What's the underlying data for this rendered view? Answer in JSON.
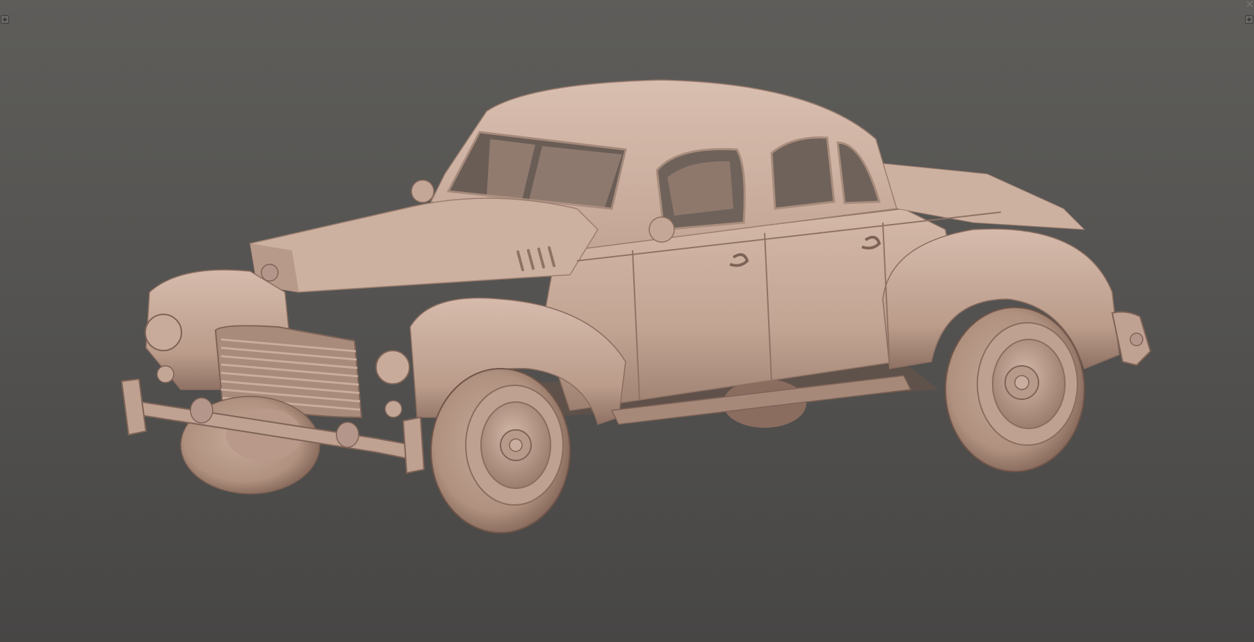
{
  "viewport": {
    "name": "3D viewport",
    "background_top": "#5e5d5a",
    "background_bottom": "#474645",
    "model_color": "#c9ad9e"
  },
  "controls": {
    "left_corner_icon": "plus-icon",
    "right_corner_icon": "plus-icon",
    "top_right_icon": "close-icon"
  },
  "model": {
    "subject": "vintage-coupe-car-sculpt",
    "material": "clay"
  }
}
